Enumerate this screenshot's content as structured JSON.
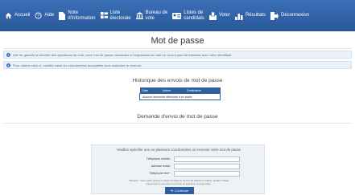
{
  "nav": {
    "items": [
      {
        "name": "nav-accueil",
        "icon": "home-icon",
        "lines": [
          "Accueil"
        ]
      },
      {
        "name": "nav-aide",
        "icon": "help-icon",
        "lines": [
          "Aide"
        ]
      },
      {
        "name": "nav-note",
        "icon": "document-icon",
        "lines": [
          "Note",
          "d'information"
        ]
      },
      {
        "name": "nav-liste-electorale",
        "icon": "list-icon",
        "lines": [
          "Liste",
          "électorale"
        ]
      },
      {
        "name": "nav-bureau-vote",
        "icon": "building-icon",
        "lines": [
          "Bureau de",
          "vote"
        ]
      },
      {
        "name": "nav-listes-candidats",
        "icon": "id-card-icon",
        "lines": [
          "Listes de",
          "candidats"
        ]
      },
      {
        "name": "nav-voter",
        "icon": "ballot-icon",
        "lines": [
          "Voter"
        ]
      },
      {
        "name": "nav-resultats",
        "icon": "bar-chart-icon",
        "lines": [
          "Résultats"
        ]
      },
      {
        "name": "nav-deconnexion",
        "icon": "logout-icon",
        "lines": [
          "Déconnexion"
        ]
      }
    ]
  },
  "page": {
    "title": "Mot de passe",
    "info1": "Afin de garantir la sécurité des opérations de vote, votre mot de passe nécessaire à l'expression du vote ne vous a pas été transmis avec votre identifiant.",
    "info2": "Pour obtenir celui-ci, veuillez saisir les coordonnées auxquelles vous souhaitez le recevoir."
  },
  "history": {
    "title": "Historique des envois de mot de passe",
    "columns": [
      "Date",
      "Auteur",
      "Destination"
    ],
    "empty": "Aucune demande effectuée à ce stade"
  },
  "request": {
    "title": "Demande d'envoi de mot de passe",
    "intro": "Veuillez spécifier une ou plusieurs coordonnées où recevoir votre mot de passe",
    "fields": [
      {
        "label": "Téléphone mobile :",
        "value": ""
      },
      {
        "label": "Adresse email :",
        "value": ""
      },
      {
        "label": "Téléphone fixe* :",
        "value": ""
      }
    ],
    "note": "*Attention : Votre option génère un appel immédiat au numéro de téléphone indiqué. Veuillez l'utiliser uniquement si vous êtes à proximité du téléphone correspondant.",
    "button": "Continuer"
  },
  "colors": {
    "navbar": "#2f62a8",
    "accent": "#2b5fa6",
    "info_bg": "#eaf1fa"
  }
}
